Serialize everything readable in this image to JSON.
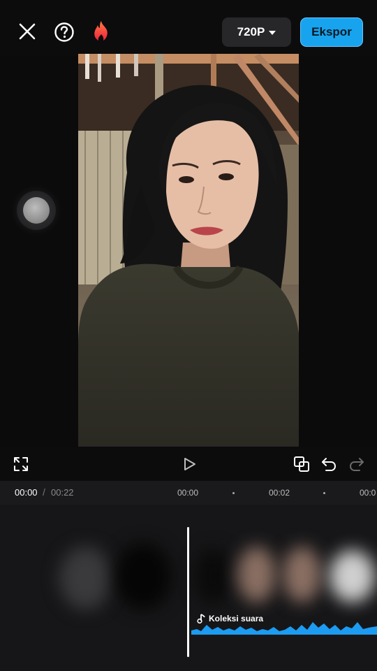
{
  "header": {
    "resolution_label": "720P",
    "export_label": "Ekspor"
  },
  "timeline": {
    "current_time": "00:00",
    "separator": "/",
    "total_time": "00:22",
    "ticks": [
      "00:00",
      "00:02",
      "00:0"
    ],
    "audio_track_label": "Koleksi suara"
  },
  "colors": {
    "accent": "#18a3ee",
    "background": "#0c0c0d",
    "waveform": "#1d9bf0"
  },
  "icons": {
    "close": "close-icon",
    "help": "help-icon",
    "fire": "fire-icon",
    "fullscreen": "fullscreen-icon",
    "play": "play-icon",
    "copy": "copy-icon",
    "undo": "undo-icon",
    "redo": "redo-icon",
    "music": "music-note-icon"
  }
}
